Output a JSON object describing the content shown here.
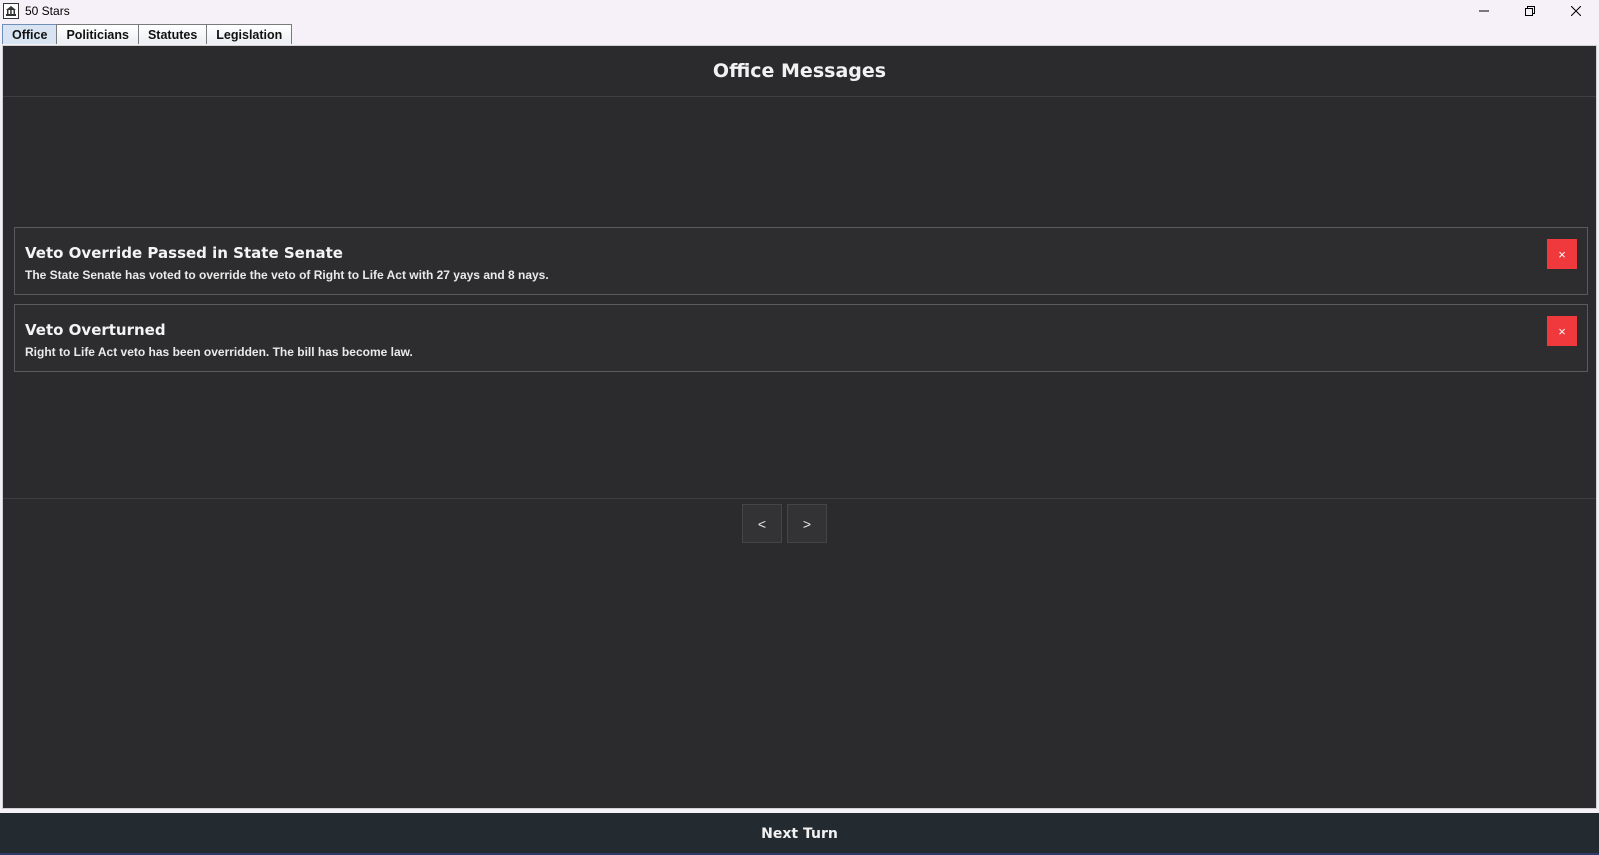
{
  "window": {
    "title": "50 Stars",
    "icon": "capitol-icon",
    "controls": [
      "minimize-icon",
      "restore-icon",
      "close-icon"
    ]
  },
  "tabs": [
    {
      "label": "Office",
      "active": true
    },
    {
      "label": "Politicians",
      "active": false
    },
    {
      "label": "Statutes",
      "active": false
    },
    {
      "label": "Legislation",
      "active": false
    }
  ],
  "office": {
    "title": "Office Messages",
    "messages": [
      {
        "title": "Veto Override Passed in State Senate",
        "body": "The State Senate has voted to override the veto of Right to Life Act with 27 yays and 8 nays.",
        "dismiss_label": "×"
      },
      {
        "title": "Veto Overturned",
        "body": "Right to Life Act veto has been overridden. The bill has become law.",
        "dismiss_label": "×"
      }
    ],
    "pager": {
      "prev_label": "<",
      "next_label": ">"
    }
  },
  "footer": {
    "next_turn_label": "Next Turn"
  },
  "colors": {
    "panel_bg": "#2b2b2d",
    "dismiss_red": "#f0393d",
    "footer_bg": "#232a30",
    "active_tab": "#d8e4f2"
  }
}
